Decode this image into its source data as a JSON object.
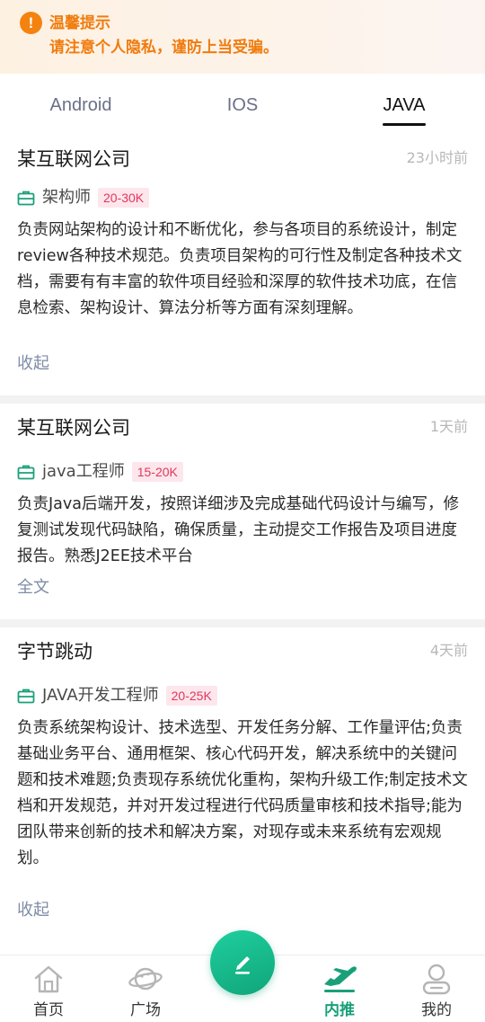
{
  "banner": {
    "icon": "exclamation-circle-icon",
    "title": "温馨提示",
    "message": "请注意个人隐私，谨防上当受骗。",
    "color": "#f07c0e"
  },
  "tabs": [
    {
      "label": "Android",
      "active": false
    },
    {
      "label": "IOS",
      "active": false
    },
    {
      "label": "JAVA",
      "active": true
    }
  ],
  "jobs": [
    {
      "company": "某互联网公司",
      "time": "23小时前",
      "position": "架构师",
      "salary": "20-30K",
      "description": "负责网站架构的设计和不断优化，参与各项目的系统设计，制定review各种技术规范。负责项目架构的可行性及制定各种技术文档，需要有有丰富的软件项目经验和深厚的软件技术功底，在信息检索、架构设计、算法分析等方面有深刻理解。",
      "toggle": "收起"
    },
    {
      "company": "某互联网公司",
      "time": "1天前",
      "position": "java工程师",
      "salary": "15-20K",
      "description": "负责Java后端开发，按照详细涉及完成基础代码设计与编写，修复测试发现代码缺陷，确保质量，主动提交工作报告及项目进度报告。熟悉J2EE技术平台",
      "toggle": "全文"
    },
    {
      "company": "字节跳动",
      "time": "4天前",
      "position": "JAVA开发工程师",
      "salary": "20-25K",
      "description": "负责系统架构设计、技术选型、开发任务分解、工作量评估;负责基础业务平台、通用框架、核心代码开发，解决系统中的关键问题和技术难题;负责现存系统优化重构，架构升级工作;制定技术文档和开发规范，并对开发过程进行代码质量审核和技术指导;能为团队带来创新的技术和解决方案，对现存或未来系统有宏观规划。",
      "toggle": "收起"
    }
  ],
  "bottom_nav": [
    {
      "label": "首页",
      "icon": "home-icon",
      "active": false
    },
    {
      "label": "广场",
      "icon": "planet-icon",
      "active": false
    },
    {
      "label": "内推",
      "icon": "airplane-icon",
      "active": true
    },
    {
      "label": "我的",
      "icon": "user-icon",
      "active": false
    }
  ],
  "fab": {
    "icon": "pencil-icon"
  },
  "colors": {
    "accent": "#1aa079",
    "salary_text": "#e0385c",
    "salary_bg": "#fde6ec",
    "link": "#7f8ca6"
  }
}
